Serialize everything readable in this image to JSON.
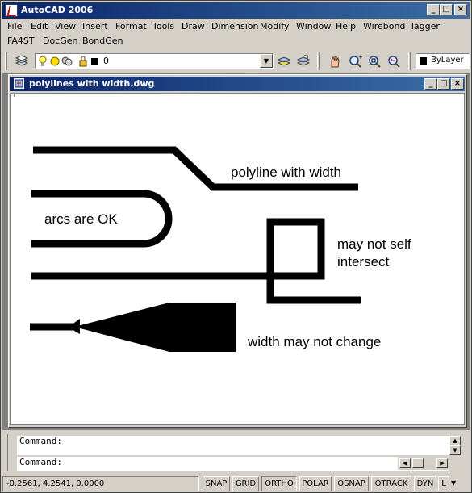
{
  "app": {
    "title": "AutoCAD 2006",
    "window_buttons": {
      "minimize": "_",
      "maximize": "□",
      "close": "×"
    }
  },
  "menubar": {
    "row1": [
      "File",
      "Edit",
      "View",
      "Insert",
      "Format",
      "Tools",
      "Draw",
      "Dimension",
      "Modify",
      "Window",
      "Help",
      "Wirebond",
      "Tagger"
    ],
    "row2": [
      "FA4ST",
      "DocGen",
      "BondGen"
    ]
  },
  "toolbar": {
    "layer_name": "0",
    "color": "ByLayer",
    "layer_color": "#000000"
  },
  "document": {
    "title": "polylines with width.dwg",
    "annotations": {
      "polyline_width": "polyline with width",
      "arcs": "arcs are OK",
      "self_intersect_1": "may not self",
      "self_intersect_2": "intersect",
      "width_change": "width may not change"
    }
  },
  "command": {
    "line1": "Command:",
    "line2": "Command:"
  },
  "statusbar": {
    "coordinates": "-0.2561, 4.2541, 0.0000",
    "buttons": [
      "SNAP",
      "GRID",
      "ORTHO",
      "POLAR",
      "OSNAP",
      "OTRACK",
      "DYN",
      "L"
    ],
    "pressed": [
      "ORTHO"
    ]
  },
  "colors": {
    "titlebar_start": "#0a246a",
    "titlebar_end": "#3a6ea5",
    "chrome": "#d4d0c8",
    "canvas": "#ffffff",
    "ink": "#000000"
  }
}
